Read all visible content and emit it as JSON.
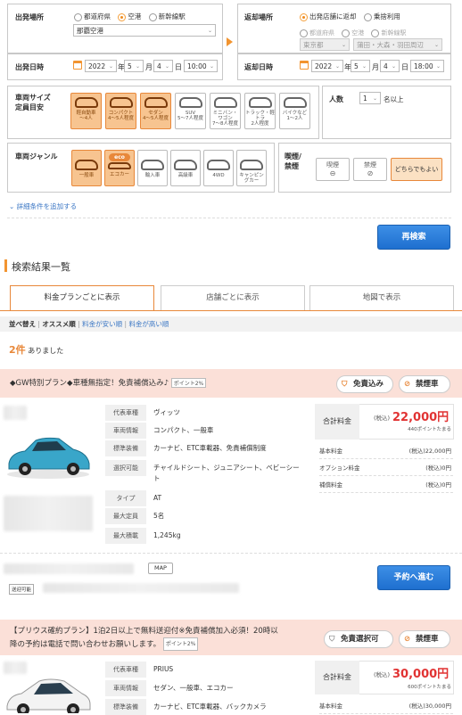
{
  "departure": {
    "place_label": "出発場所",
    "radios": [
      "都道府県",
      "空港",
      "新幹線駅"
    ],
    "selected_radio": 1,
    "place_select": "那覇空港",
    "date_label": "出発日時",
    "year": "2022",
    "year_unit": "年",
    "month": "5",
    "month_unit": "月",
    "day": "4",
    "day_unit": "日",
    "time": "10:00"
  },
  "return": {
    "place_label": "返却場所",
    "radios": [
      "出発店舗に返却",
      "乗捨利用"
    ],
    "selected_radio": 0,
    "sub_radios": [
      "都道府県",
      "空港",
      "新幹線駅"
    ],
    "pref_select": "東京都",
    "area_select": "蒲田・大森・羽田周辺",
    "date_label": "返却日時",
    "year": "2022",
    "year_unit": "年",
    "month": "5",
    "month_unit": "月",
    "day": "4",
    "day_unit": "日",
    "time": "18:00"
  },
  "size": {
    "label_line1": "車両サイズ",
    "label_line2": "定員目安",
    "tiles": [
      {
        "l1": "軽自動車",
        "l2": "〜4人",
        "on": true,
        "icon": "kei-car-icon"
      },
      {
        "l1": "コンパクト",
        "l2": "4〜5人程度",
        "on": true,
        "icon": "compact-car-icon"
      },
      {
        "l1": "セダン",
        "l2": "4〜5人程度",
        "on": true,
        "icon": "sedan-car-icon"
      },
      {
        "l1": "SUV",
        "l2": "5〜7人程度",
        "on": false,
        "icon": "suv-car-icon"
      },
      {
        "l1": "ミニバン・ワゴン",
        "l2": "7〜8人程度",
        "on": false,
        "icon": "minivan-icon"
      },
      {
        "l1": "トラック・軽トラ",
        "l2": "2人程度",
        "on": false,
        "icon": "truck-icon"
      },
      {
        "l1": "バイクなど",
        "l2": "1〜2人",
        "on": false,
        "icon": "bike-icon"
      }
    ]
  },
  "people": {
    "label": "人数",
    "value": "1",
    "suffix": "名以上"
  },
  "genre": {
    "label": "車両ジャンル",
    "tiles": [
      {
        "l1": "一般車",
        "on": true,
        "icon": "regular-car-icon"
      },
      {
        "l1": "エコカー",
        "on": true,
        "icon": "eco-car-icon",
        "eco": "eco"
      },
      {
        "l1": "輸入車",
        "on": false,
        "icon": "import-car-icon"
      },
      {
        "l1": "高級車",
        "on": false,
        "icon": "luxury-car-icon"
      },
      {
        "l1": "4WD",
        "on": false,
        "icon": "4wd-car-icon"
      },
      {
        "l1": "キャンピングカー",
        "on": false,
        "icon": "camping-car-icon"
      }
    ]
  },
  "smoking": {
    "label_line1": "喫煙/",
    "label_line2": "禁煙",
    "options": [
      "喫煙",
      "禁煙",
      "どちらでもよい"
    ],
    "selected": 2
  },
  "more_conditions": "詳細条件を追加する",
  "research_button": "再検索",
  "results": {
    "title": "検索結果一覧",
    "tabs": [
      "料金プランごとに表示",
      "店舗ごとに表示",
      "地図で表示"
    ],
    "active_tab": 0,
    "sort_label": "並べ替え",
    "sort_active": "オススメ順",
    "sort_options": [
      "料金が安い順",
      "料金が高い順"
    ],
    "count": "2件",
    "count_suffix": "ありました"
  },
  "plans": [
    {
      "title": "◆GW特別プラン◆車種無指定！免責補償込み♪",
      "points": "ポイント2%",
      "tag1": "免責込み",
      "tag2": "禁煙車",
      "specs": [
        {
          "k": "代表車種",
          "v": "ヴィッツ"
        },
        {
          "k": "車両情報",
          "v": "コンパクト、一般車"
        },
        {
          "k": "標準装備",
          "v": "カーナビ、ETC車載器、免責補償制度"
        },
        {
          "k": "選択可能",
          "v": "チャイルドシート、ジュニアシート、ベビーシー"
        },
        {
          "k": "",
          "v": "ト"
        },
        {
          "k": "タイプ",
          "v": "AT"
        },
        {
          "k": "最大定員",
          "v": "5名"
        },
        {
          "k": "最大積載",
          "v": "1,245kg"
        }
      ],
      "total_label": "合計料金",
      "tax": "(税込)",
      "total": "22,000円",
      "points_note": "440ポイントたまる",
      "breakdown": [
        {
          "k": "基本料金",
          "v": "(税込)22,000円"
        },
        {
          "k": "オプション料金",
          "v": "(税込)0円"
        },
        {
          "k": "補償料金",
          "v": "(税込)0円"
        }
      ],
      "map_label": "MAP",
      "shuttle_label": "送迎可能",
      "reserve_button": "予約へ進む",
      "car_color": "#39a6c9"
    },
    {
      "title": "【プリウス確約プラン】1泊2日以上で無料送迎付※免責補償加入必須！20時以降の予約は電話で問い合わせお願いします。",
      "title_line1": "【プリウス確約プラン】1泊2日以上で無料送迎付※免責補償加入必須！20時以",
      "title_line2": "降の予約は電話で問い合わせお願いします。",
      "points": "ポイント2%",
      "tag1": "免責選択可",
      "tag2": "禁煙車",
      "specs": [
        {
          "k": "代表車種",
          "v": "PRIUS"
        },
        {
          "k": "車両情報",
          "v": "セダン、一般車、エコカー"
        },
        {
          "k": "標準装備",
          "v": "カーナビ、ETC車載器、バックカメラ"
        }
      ],
      "total_label": "合計料金",
      "tax": "(税込)",
      "total": "30,000円",
      "points_note": "600ポイントたまる",
      "breakdown": [
        {
          "k": "基本料金",
          "v": "(税込)30,000円"
        }
      ],
      "car_color": "#e8e8e8"
    }
  ]
}
